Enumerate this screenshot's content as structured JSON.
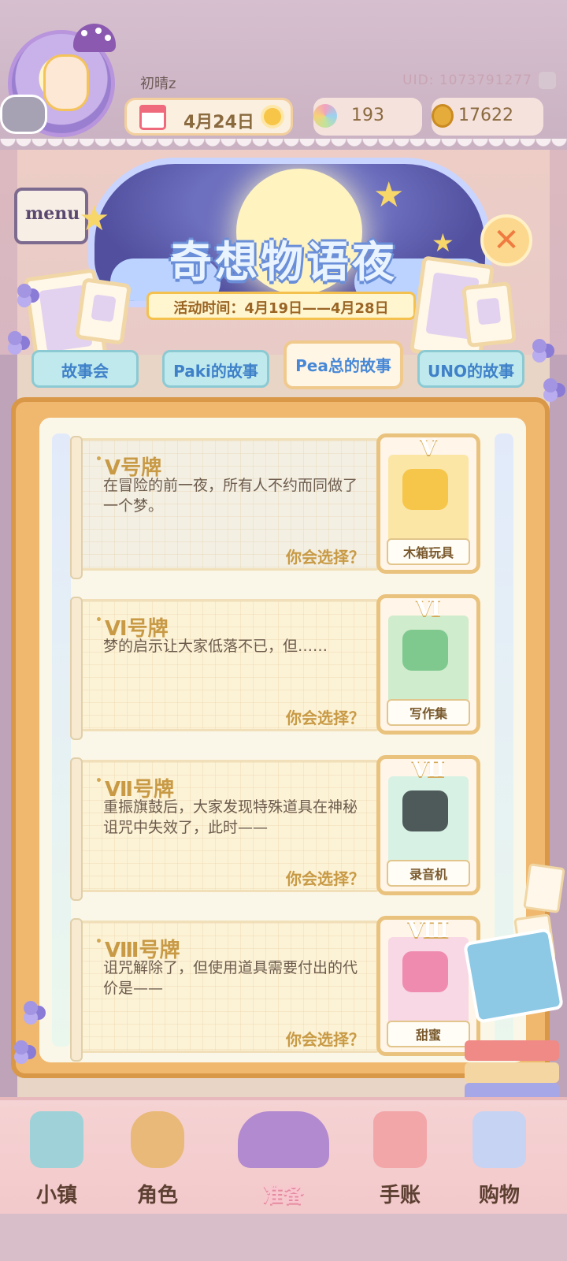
{
  "header": {
    "username": "初晴z",
    "uid": "UID: 1073791277",
    "date": "4月24日",
    "gems": "193",
    "coins": "17622"
  },
  "event": {
    "title": "奇想物语夜",
    "period": "活动时间：4月19日——4月28日"
  },
  "decor": {
    "menu_sign": "menu"
  },
  "tabs": [
    {
      "label": "故事会"
    },
    {
      "label": "Paki的故事"
    },
    {
      "label": "Pea总的故事"
    },
    {
      "label": "UNO的故事"
    }
  ],
  "stories": [
    {
      "title": "Ⅴ号牌",
      "desc": "在冒险的前一夜，所有人不约而同做了一个梦。",
      "prompt": "你会选择？",
      "numeral": "Ⅴ",
      "card_name": "木箱玩具",
      "card_color": "#f6c64a"
    },
    {
      "title": "Ⅵ号牌",
      "desc": "梦的启示让大家低落不已，但……",
      "prompt": "你会选择？",
      "numeral": "Ⅵ",
      "card_name": "写作集",
      "card_color": "#7fc98f"
    },
    {
      "title": "Ⅶ号牌",
      "desc": "重振旗鼓后，大家发现特殊道具在神秘诅咒中失效了，此时——",
      "prompt": "你会选择？",
      "numeral": "Ⅶ",
      "card_name": "录音机",
      "card_color": "#9fdcc3"
    },
    {
      "title": "Ⅷ号牌",
      "desc": "诅咒解除了，但使用道具需要付出的代价是——",
      "prompt": "你会选择？",
      "numeral": "Ⅷ",
      "card_name": "甜蜜",
      "card_color": "#f3a9c6"
    }
  ],
  "nav": [
    {
      "label": "小镇",
      "icon": "map-icon"
    },
    {
      "label": "角色",
      "icon": "character-icon"
    },
    {
      "label": "准备",
      "icon": "hat-icon"
    },
    {
      "label": "手账",
      "icon": "notebook-icon"
    },
    {
      "label": "购物",
      "icon": "shopping-bag-icon"
    }
  ],
  "colors": {
    "accent_blue": "#3f81c9",
    "gold_text": "#c89a45",
    "board": "#f0b86e"
  }
}
